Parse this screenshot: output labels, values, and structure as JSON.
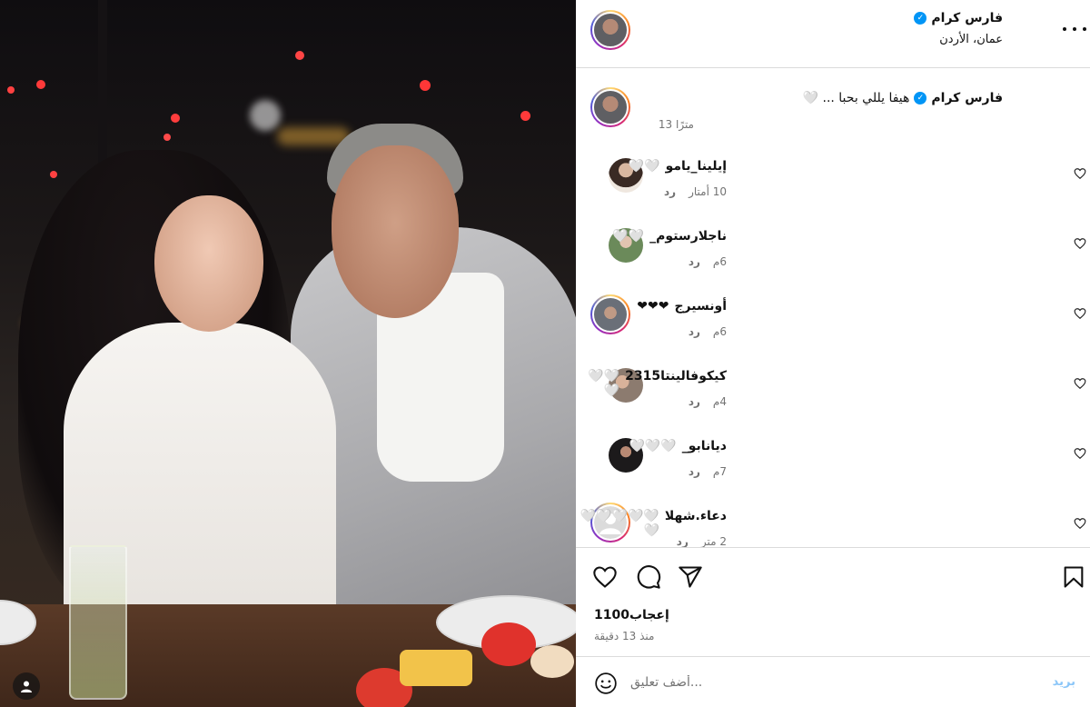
{
  "post": {
    "author": "فارس كرام",
    "location": "عمان، الأردن",
    "caption": "هيفا يللي بحبا ... 🤍",
    "caption_time": "13 مترًا",
    "likes": "1100إعجاب",
    "time": "منذ 13 دقيقة"
  },
  "comments": [
    {
      "user": "إيلينا_يامو",
      "text": "🤍🤍",
      "time": "10 أمتار",
      "reply": "رد"
    },
    {
      "user": "ناجلارستوم_",
      "text": "🤍🤍",
      "time": "6م",
      "reply": "رد"
    },
    {
      "user": "أونسيرج",
      "text": "❤❤❤",
      "time": "6م",
      "reply": "رد"
    },
    {
      "user": "كيكوفالينتا2315",
      "text": "🤍🤍🤍",
      "time": "4م",
      "reply": "رد"
    },
    {
      "user": "ديانابو_",
      "text": "🤍🤍🤍",
      "time": "7م",
      "reply": "رد"
    },
    {
      "user": "دعاء.شهلا",
      "text": "🤍🤍🤍🤍🤍🤍",
      "time": "2 متر",
      "reply": "رد"
    }
  ],
  "add_comment": {
    "placeholder": "أضف تعليق...",
    "post_label": "بريد"
  },
  "icons": {
    "verified": "verified-badge-icon",
    "more": "more-options-icon",
    "like": "heart-icon",
    "comment": "comment-icon",
    "share": "share-icon",
    "save": "bookmark-icon",
    "emoji": "emoji-icon",
    "tag": "user-tag-icon"
  },
  "colors": {
    "verified": "#0095f6",
    "muted_text": "#737373",
    "post_button": "#8bc6f8"
  }
}
